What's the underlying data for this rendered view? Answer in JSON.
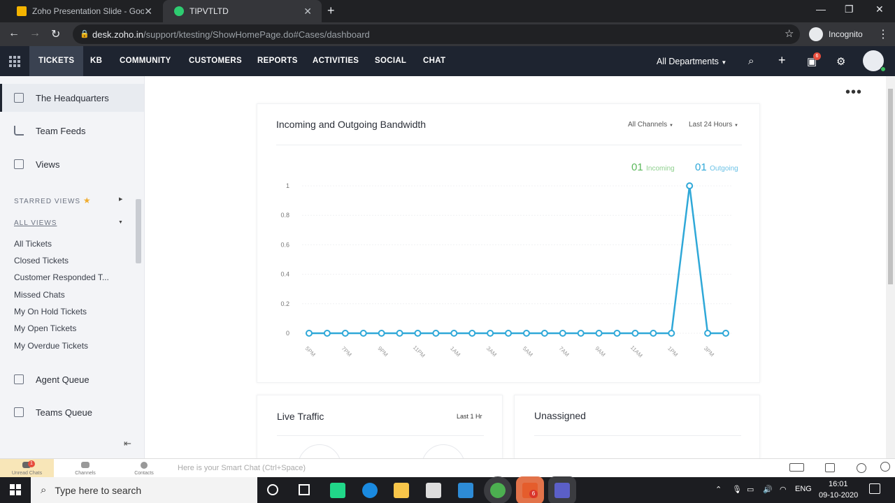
{
  "browser": {
    "tabs": [
      {
        "title": "Zoho Presentation Slide - Google",
        "active": false
      },
      {
        "title": "TIPVTLTD",
        "active": true
      }
    ],
    "url_host": "desk.zoho.in",
    "url_path": "/support/ktesting/ShowHomePage.do#Cases/dashboard",
    "incognito_label": "Incognito"
  },
  "nav": {
    "tabs": [
      "TICKETS",
      "KB",
      "COMMUNITY",
      "CUSTOMERS",
      "REPORTS",
      "ACTIVITIES",
      "SOCIAL",
      "CHAT"
    ],
    "department": "All Departments",
    "notification_count": "6"
  },
  "sidebar": {
    "items": [
      {
        "label": "The Headquarters",
        "icon": "dashboard-icon"
      },
      {
        "label": "Team Feeds",
        "icon": "feed-icon"
      },
      {
        "label": "Views",
        "icon": "views-icon"
      }
    ],
    "starred_label": "STARRED VIEWS",
    "all_views_label": "ALL VIEWS",
    "views": [
      "All Tickets",
      "Closed Tickets",
      "Customer Responded T...",
      "Missed Chats",
      "My On Hold Tickets",
      "My Open Tickets",
      "My Overdue Tickets"
    ],
    "queues": [
      {
        "label": "Agent Queue",
        "icon": "agent-queue-icon"
      },
      {
        "label": "Teams Queue",
        "icon": "teams-queue-icon"
      }
    ]
  },
  "bandwidth_card": {
    "title": "Incoming and Outgoing Bandwidth",
    "channel_filter": "All Channels",
    "time_filter": "Last 24 Hours",
    "incoming_count": "01",
    "incoming_label": "Incoming",
    "outgoing_count": "01",
    "outgoing_label": "Outgoing"
  },
  "live_traffic": {
    "title": "Live Traffic",
    "filter": "Last 1 Hr"
  },
  "unassigned": {
    "title": "Unassigned"
  },
  "bottom_bar": {
    "unread_chats": "Unread Chats",
    "channels": "Channels",
    "contacts": "Contacts",
    "smart_chat_placeholder": "Here is your Smart Chat (Ctrl+Space)",
    "unread_badge": "1"
  },
  "taskbar": {
    "search_placeholder": "Type here to search",
    "lang": "ENG",
    "time": "16:01",
    "date": "09-10-2020",
    "badge": "6"
  },
  "chart_data": {
    "type": "line",
    "title": "Incoming and Outgoing Bandwidth",
    "x": [
      "5PM",
      "6PM",
      "7PM",
      "8PM",
      "9PM",
      "10PM",
      "11PM",
      "12AM",
      "1AM",
      "2AM",
      "3AM",
      "4AM",
      "5AM",
      "6AM",
      "7AM",
      "8AM",
      "9AM",
      "10AM",
      "11AM",
      "12PM",
      "1PM",
      "2PM",
      "3PM",
      "4PM"
    ],
    "x_tick_labels": [
      "5PM",
      "7PM",
      "9PM",
      "11PM",
      "1AM",
      "3AM",
      "5AM",
      "7AM",
      "9AM",
      "11AM",
      "1PM",
      "3PM"
    ],
    "series": [
      {
        "values": [
          0,
          0,
          0,
          0,
          0,
          0,
          0,
          0,
          0,
          0,
          0,
          0,
          0,
          0,
          0,
          0,
          0,
          0,
          0,
          0,
          0,
          1,
          0,
          0
        ]
      }
    ],
    "ylim": [
      0,
      1
    ],
    "y_ticks": [
      "0",
      "0.2",
      "0.4",
      "0.6",
      "0.8",
      "1"
    ],
    "grid": true,
    "colors": {
      "incoming": "#5cb85c",
      "outgoing": "#2fa8d8"
    }
  }
}
